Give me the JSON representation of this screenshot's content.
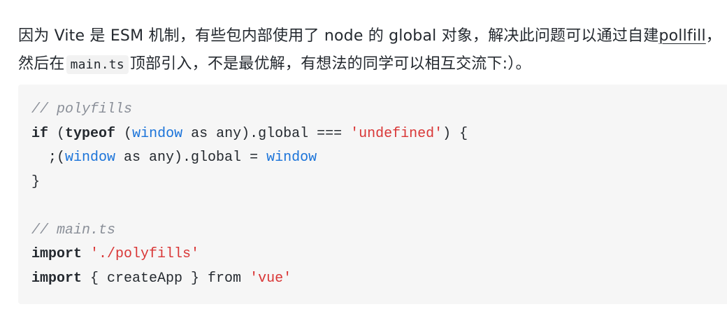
{
  "paragraph": {
    "text_before_link": "因为 Vite 是 ESM 机制，有些包内部使用了 node 的 global 对象，解决此问题可以通过自建",
    "link_text": "pollfill",
    "text_after_link": "，然后在",
    "inline_code": "main.ts",
    "text_after_code": "顶部引入，不是最优解，有想法的同学可以相互交流下:）。"
  },
  "code": {
    "language": "typescript",
    "lines": [
      [
        {
          "t": "comment",
          "v": "// polyfills"
        }
      ],
      [
        {
          "t": "kw",
          "v": "if"
        },
        {
          "t": "plain",
          "v": " ("
        },
        {
          "t": "kw",
          "v": "typeof"
        },
        {
          "t": "plain",
          "v": " ("
        },
        {
          "t": "builtin",
          "v": "window"
        },
        {
          "t": "plain",
          "v": " as any).global === "
        },
        {
          "t": "str",
          "v": "'undefined'"
        },
        {
          "t": "plain",
          "v": ") {"
        }
      ],
      [
        {
          "t": "plain",
          "v": "  ;("
        },
        {
          "t": "builtin",
          "v": "window"
        },
        {
          "t": "plain",
          "v": " as any).global = "
        },
        {
          "t": "builtin",
          "v": "window"
        }
      ],
      [
        {
          "t": "plain",
          "v": "}"
        }
      ],
      [
        {
          "t": "plain",
          "v": ""
        }
      ],
      [
        {
          "t": "comment",
          "v": "// main.ts"
        }
      ],
      [
        {
          "t": "kw",
          "v": "import"
        },
        {
          "t": "plain",
          "v": " "
        },
        {
          "t": "str",
          "v": "'./polyfills'"
        }
      ],
      [
        {
          "t": "kw",
          "v": "import"
        },
        {
          "t": "plain",
          "v": " { createApp } from "
        },
        {
          "t": "str",
          "v": "'vue'"
        }
      ]
    ]
  }
}
